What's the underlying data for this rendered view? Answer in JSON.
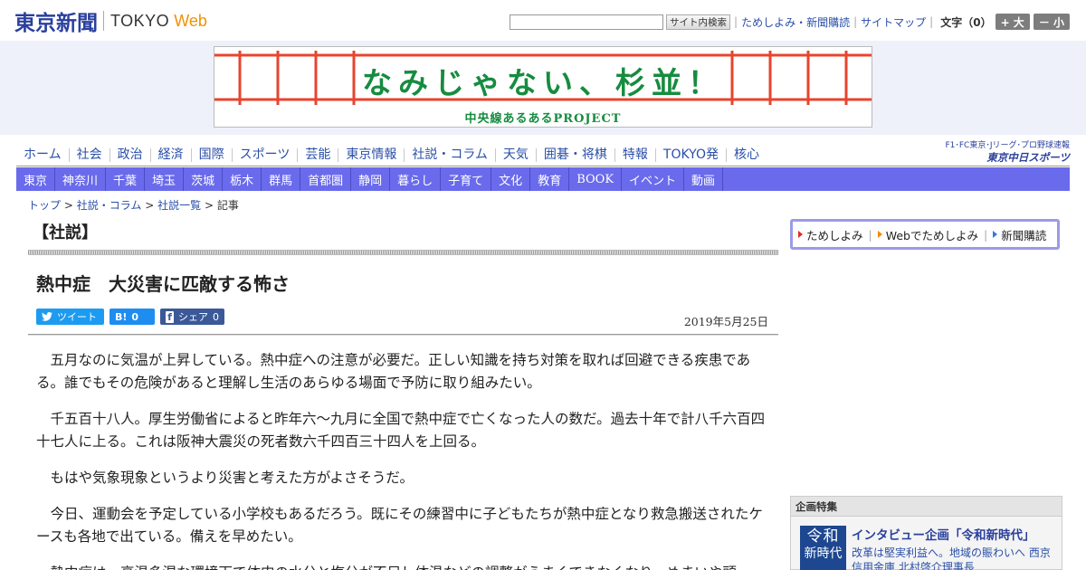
{
  "header": {
    "logo_jp": "東京新聞",
    "logo_tokyo": "TOKYO",
    "logo_web": "Web",
    "search_button": "サイト内検索",
    "links": [
      "ためしよみ・新聞購読",
      "サイトマップ"
    ],
    "font_size_label": "文字（0）",
    "font_larger": "+ 大",
    "font_smaller": "－ 小"
  },
  "banner": {
    "title": "なみじゃない、杉並！",
    "subtitle": "中央線あるあるPROJECT",
    "accent_color": "#168c3f"
  },
  "nav_primary": [
    "ホーム",
    "社会",
    "政治",
    "経済",
    "国際",
    "スポーツ",
    "芸能",
    "東京情報",
    "社説・コラム",
    "天気",
    "囲碁・将棋",
    "特報",
    "TOKYO発",
    "核心"
  ],
  "chunichi": {
    "top": "F1･FC東京･Jリーグ･プロ野球速報",
    "bottom": "東京中日スポーツ"
  },
  "nav_secondary": [
    "東京",
    "神奈川",
    "千葉",
    "埼玉",
    "茨城",
    "栃木",
    "群馬",
    "首都圏",
    "静岡",
    "暮らし",
    "子育て",
    "文化",
    "教育",
    "BOOK",
    "イベント",
    "動画"
  ],
  "breadcrumb": {
    "items": [
      "トップ",
      "社説・コラム",
      "社説一覧"
    ],
    "current": "記事",
    "separator": ">"
  },
  "article": {
    "section": "【社説】",
    "title": "熱中症　大災害に匹敵する怖さ",
    "date": "2019年5月25日",
    "share": {
      "tweet_label": "ツイート",
      "hatena_label": "B!",
      "hatena_count": "0",
      "facebook_label": "シェア",
      "facebook_count": "0"
    },
    "paragraphs": [
      "五月なのに気温が上昇している。熱中症への注意が必要だ。正しい知識を持ち対策を取れば回避できる疾患である。誰でもその危険があると理解し生活のあらゆる場面で予防に取り組みたい。",
      "千五百十八人。厚生労働省によると昨年六～九月に全国で熱中症で亡くなった人の数だ。過去十年で計八千六百四十七人に上る。これは阪神大震災の死者数六千四百三十四人を上回る。",
      "もはや気象現象というより災害と考えた方がよさそうだ。",
      "今日、運動会を予定している小学校もあるだろう。既にその練習中に子どもたちが熱中症となり救急搬送されたケースも各地で出ている。備えを早めたい。",
      "熱中症は、高温多湿な環境下で体内の水分と塩分が不足し体温などの調整がうまくできなくなり、めまいや頭"
    ]
  },
  "sidebar": {
    "subscribe": [
      "ためしよみ",
      "Webでためしよみ",
      "新聞購読"
    ],
    "kikaku": {
      "heading": "企画特集",
      "badge_line1": "令和",
      "badge_line2": "新時代",
      "title": "インタビュー企画「令和新時代」",
      "text": "改革は堅実利益へ。地域の賑わいへ 西京信用金庫 北村啓介理事長"
    }
  }
}
